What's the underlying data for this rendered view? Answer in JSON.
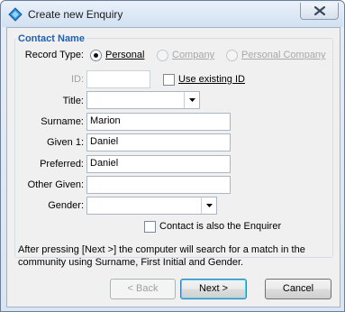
{
  "window": {
    "title": "Create new Enquiry"
  },
  "group": {
    "title": "Contact Name"
  },
  "record_type": {
    "label": "Record Type:",
    "options": [
      {
        "label": "Personal",
        "selected": true,
        "enabled": true
      },
      {
        "label": "Company",
        "selected": false,
        "enabled": false
      },
      {
        "label": "Personal Company",
        "selected": false,
        "enabled": false
      }
    ]
  },
  "id": {
    "label": "ID:",
    "value": "",
    "use_existing_label": "Use existing ID",
    "use_existing_checked": false
  },
  "fields": {
    "title": {
      "label": "Title:",
      "value": ""
    },
    "surname": {
      "label": "Surname:",
      "value": "Marion"
    },
    "given1": {
      "label": "Given 1:",
      "value": "Daniel"
    },
    "preferred": {
      "label": "Preferred:",
      "value": "Daniel"
    },
    "other_given": {
      "label": "Other Given:",
      "value": ""
    },
    "gender": {
      "label": "Gender:",
      "value": ""
    }
  },
  "enquirer": {
    "label": "Contact is also the Enquirer",
    "checked": false
  },
  "info_text": "After pressing [Next >] the computer will search for a match in the community using Surname, First Initial and Gender.",
  "buttons": {
    "back": "< Back",
    "next": "Next >",
    "cancel": "Cancel"
  },
  "colors": {
    "accent": "#1f5fb4",
    "window_frame": "#d9e5f3"
  },
  "icons": {
    "app": "diamond-app-icon",
    "close": "close-icon",
    "dropdown": "chevron-down-icon"
  }
}
